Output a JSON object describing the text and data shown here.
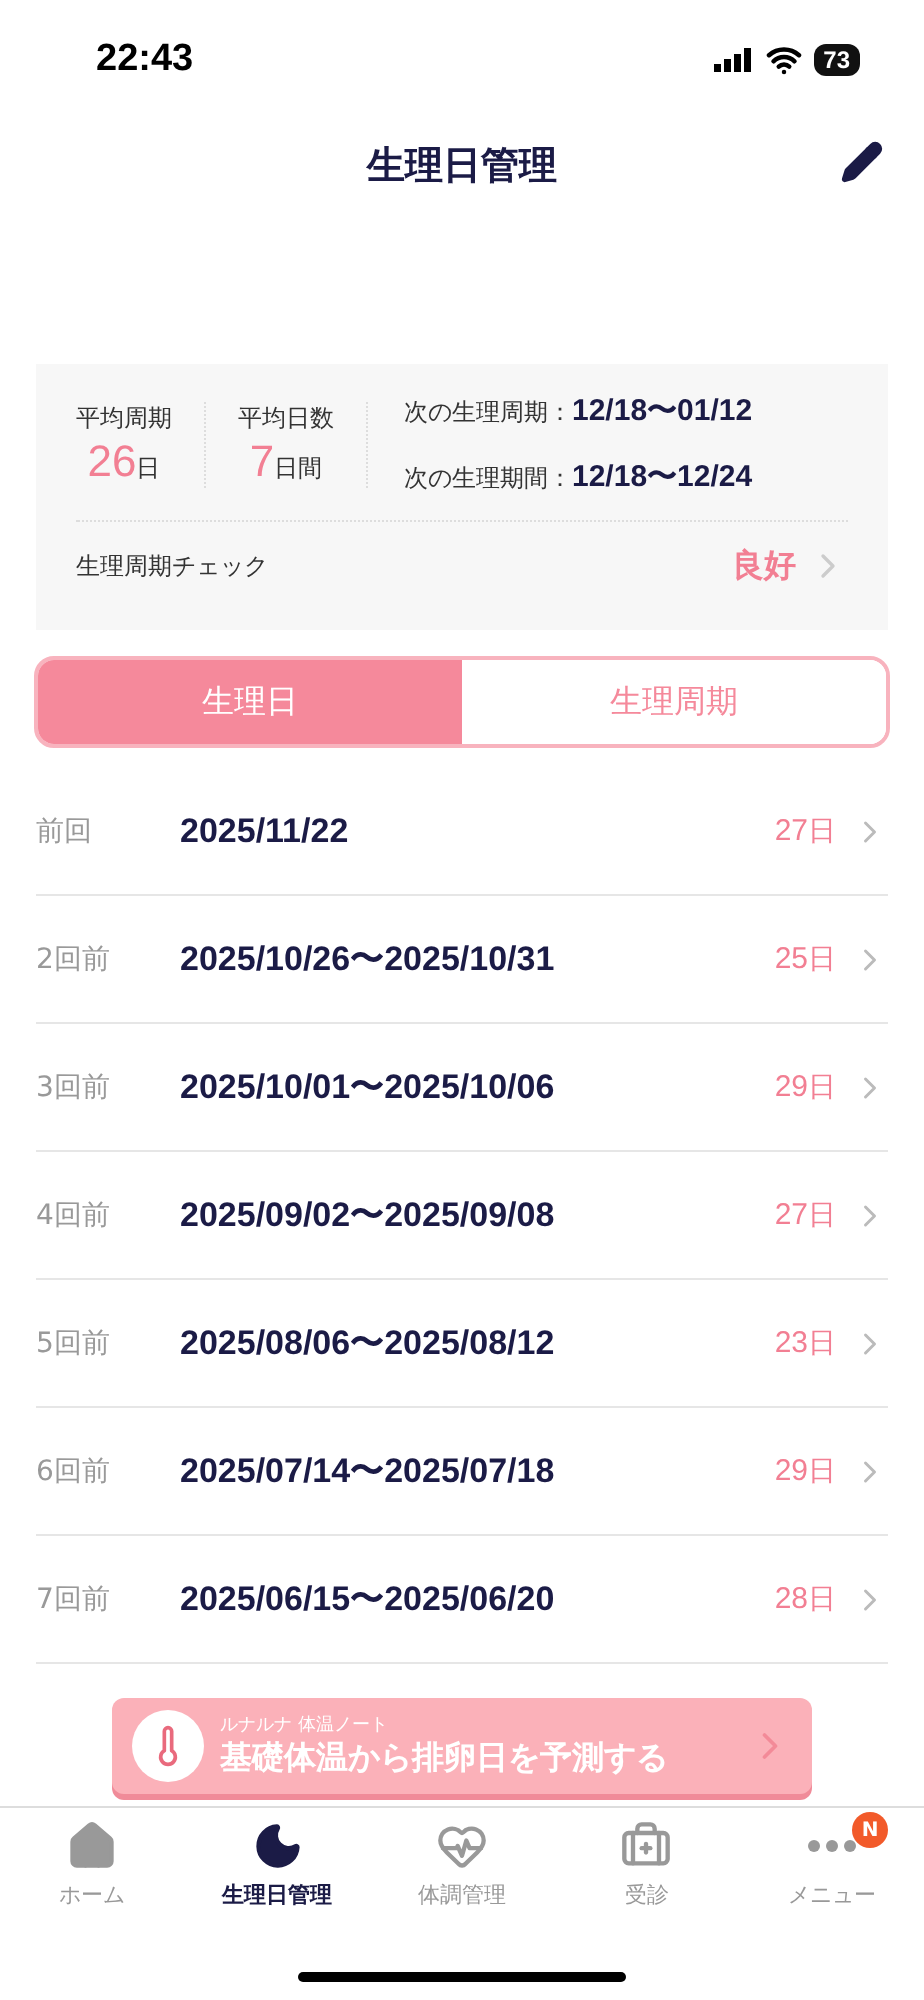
{
  "status_bar": {
    "time": "22:43",
    "battery": "73"
  },
  "header": {
    "title": "生理日管理"
  },
  "summary": {
    "stats": [
      {
        "label": "平均周期",
        "value": "26",
        "unit": "日"
      },
      {
        "label": "平均日数",
        "value": "7",
        "unit": "日間"
      }
    ],
    "next": [
      {
        "label": "次の生理周期：",
        "value": "12/18〜01/12"
      },
      {
        "label": "次の生理期間：",
        "value": "12/18〜12/24"
      }
    ],
    "check": {
      "label": "生理周期チェック",
      "value": "良好"
    }
  },
  "tabs": [
    {
      "label": "生理日",
      "selected": true
    },
    {
      "label": "生理周期",
      "selected": false
    }
  ],
  "history": [
    {
      "label": "前回",
      "dates": "2025/11/22",
      "days": "27",
      "unit": "日"
    },
    {
      "label": "2回前",
      "dates": "2025/10/26〜2025/10/31",
      "days": "25",
      "unit": "日"
    },
    {
      "label": "3回前",
      "dates": "2025/10/01〜2025/10/06",
      "days": "29",
      "unit": "日"
    },
    {
      "label": "4回前",
      "dates": "2025/09/02〜2025/09/08",
      "days": "27",
      "unit": "日"
    },
    {
      "label": "5回前",
      "dates": "2025/08/06〜2025/08/12",
      "days": "23",
      "unit": "日"
    },
    {
      "label": "6回前",
      "dates": "2025/07/14〜2025/07/18",
      "days": "29",
      "unit": "日"
    },
    {
      "label": "7回前",
      "dates": "2025/06/15〜2025/06/20",
      "days": "28",
      "unit": "日"
    }
  ],
  "banner": {
    "subtitle": "ルナルナ 体温ノート",
    "title": "基礎体温から排卵日を予測する"
  },
  "nav": [
    {
      "kind": "home",
      "label": "ホーム",
      "selected": false
    },
    {
      "kind": "moon",
      "label": "生理日管理",
      "selected": true
    },
    {
      "kind": "heart",
      "label": "体調管理",
      "selected": false
    },
    {
      "kind": "clinic",
      "label": "受診",
      "selected": false
    },
    {
      "kind": "menu",
      "label": "メニュー",
      "selected": false,
      "badge": "N"
    }
  ]
}
